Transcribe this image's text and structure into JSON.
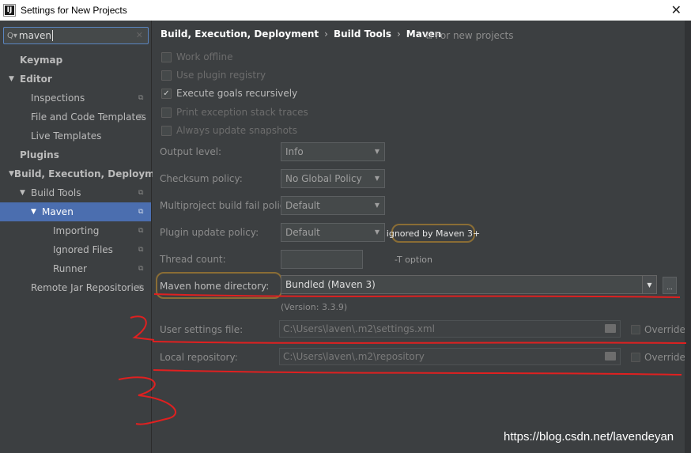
{
  "window": {
    "icon": "IJ",
    "title": "Settings for New Projects",
    "close_glyph": "✕"
  },
  "search": {
    "value": "maven",
    "icon": "search-icon",
    "clear_icon": "clear-icon"
  },
  "sidebar": {
    "items": [
      {
        "label": "Keymap"
      },
      {
        "label": "Editor"
      },
      {
        "label": "Inspections"
      },
      {
        "label": "File and Code Templates"
      },
      {
        "label": "Live Templates"
      },
      {
        "label": "Plugins"
      },
      {
        "label": "Build, Execution, Deployment"
      },
      {
        "label": "Build Tools"
      },
      {
        "label": "Maven"
      },
      {
        "label": "Importing"
      },
      {
        "label": "Ignored Files"
      },
      {
        "label": "Runner"
      },
      {
        "label": "Remote Jar Repositories"
      }
    ]
  },
  "breadcrumb": {
    "part1": "Build, Execution, Deployment",
    "part2": "Build Tools",
    "part3": "Maven",
    "separator": "›",
    "scope": "⧉ For new projects"
  },
  "options": {
    "work_offline": {
      "label": "Work offline",
      "checked": false
    },
    "use_plugin_registry": {
      "label": "Use plugin registry",
      "checked": false
    },
    "execute_goals_recursively": {
      "label": "Execute goals recursively",
      "checked": true
    },
    "print_exception_stack_traces": {
      "label": "Print exception stack traces",
      "checked": false
    },
    "always_update_snapshots": {
      "label": "Always update snapshots",
      "checked": false
    }
  },
  "fields": {
    "output_level": {
      "label": "Output level:",
      "value": "Info"
    },
    "checksum_policy": {
      "label": "Checksum policy:",
      "value": "No Global Policy"
    },
    "multiproject_fail_policy": {
      "label": "Multiproject build fail policy:",
      "value": "Default"
    },
    "plugin_update_policy": {
      "label": "Plugin update policy:",
      "value": "Default",
      "note": "ignored by Maven 3+"
    },
    "thread_count": {
      "label": "Thread count:",
      "value": "",
      "hint": "-T option"
    },
    "maven_home": {
      "label": "Maven home directory:",
      "value": "Bundled (Maven 3)",
      "version": "(Version: 3.3.9)",
      "browse": "..."
    },
    "user_settings": {
      "label": "User settings file:",
      "value": "C:\\Users\\laven\\.m2\\settings.xml",
      "override": "Override"
    },
    "local_repository": {
      "label": "Local repository:",
      "value": "C:\\Users\\laven\\.m2\\repository",
      "override": "Override"
    }
  },
  "annotation_colors": {
    "red": "#e02020",
    "highlight": "#8a6d35",
    "selection": "#4b6eaf"
  },
  "watermark": "https://blog.csdn.net/lavendeyan"
}
